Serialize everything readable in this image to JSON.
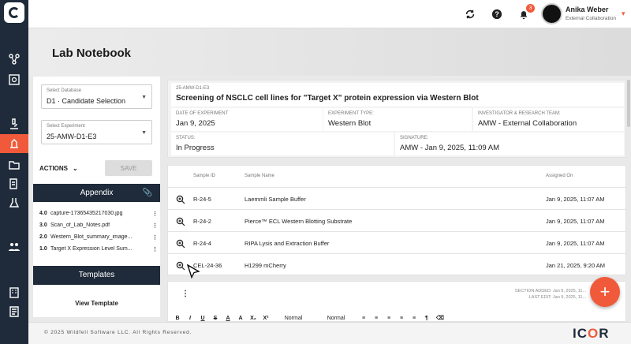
{
  "app": {
    "page_title": "Lab Notebook"
  },
  "user": {
    "name": "Anika Weber",
    "role": "External Collaboration",
    "notification_count": "3"
  },
  "nav": {
    "icons": [
      "logo-icon",
      "molecule-icon",
      "flask-grid-icon",
      "microscope-icon",
      "lab-notebook-icon",
      "folder-icon",
      "document-edit-icon",
      "experiment-icon",
      "team-icon",
      "building-icon",
      "report-icon"
    ]
  },
  "selectors": {
    "database": {
      "label": "Select Database",
      "value": "D1 · Candidate Selection"
    },
    "experiment": {
      "label": "Select Experiment",
      "value": "25-AMW-D1-E3"
    }
  },
  "actions": {
    "actions_label": "ACTIONS",
    "save_label": "SAVE"
  },
  "appendix": {
    "title": "Appendix",
    "items": [
      {
        "version": "4.0",
        "name": "capture-17365435217030.jpg"
      },
      {
        "version": "3.0",
        "name": "Scan_of_Lab_Notes.pdf"
      },
      {
        "version": "2.0",
        "name": "Western_Blot_summary_image..."
      },
      {
        "version": "1.0",
        "name": "Target X Expression Level Sum..."
      }
    ]
  },
  "templates": {
    "title": "Templates",
    "view_label": "View Template"
  },
  "experiment": {
    "id": "25-AMW-D1-E3",
    "title": "Screening of NSCLC cell lines for \"Target X\" protein expression via Western Blot",
    "date_label": "DATE OF EXPERIMENT",
    "date": "Jan 9, 2025",
    "type_label": "EXPERIMENT TYPE:",
    "type": "Western Blot",
    "investigator_label": "INVESTIGATOR & RESEARCH TEAM:",
    "investigator": "AMW - External Collaboration",
    "status_label": "STATUS:",
    "status": "In Progress",
    "signature_label": "SIGNATURE:",
    "signature": "AMW - Jan 9, 2025, 11:09 AM"
  },
  "samples": {
    "headers": {
      "id": "Sample ID",
      "name": "Sample Name",
      "assigned": "Assigned On"
    },
    "rows": [
      {
        "id": "R-24-5",
        "name": "Laemmli Sample Buffer",
        "assigned": "Jan 9, 2025, 11:07 AM"
      },
      {
        "id": "R-24-2",
        "name": "Pierce™ ECL Western Blotting Substrate",
        "assigned": "Jan 9, 2025, 11:07 AM"
      },
      {
        "id": "R-24-4",
        "name": "RIPA Lysis and Extraction Buffer",
        "assigned": "Jan 9, 2025, 11:07 AM"
      },
      {
        "id": "CEL-24-36",
        "name": "H1299 mCherry",
        "assigned": "Jan 21, 2025, 9:20 AM"
      }
    ]
  },
  "editor": {
    "section_added": "SECTION ADDED: Jan 9, 2025, 11...",
    "last_edit": "LAST EDIT: Jan 9, 2025, 11...",
    "toolbar": [
      "B",
      "I",
      "U",
      "S",
      "A",
      "A",
      "X₂",
      "X²",
      "Normal",
      "Normal",
      "≡",
      "≡",
      "≡",
      "≡",
      "≡",
      "¶",
      "⌫"
    ]
  },
  "footer": {
    "copyright": "© 2025 Wildfell Software LLC. All Rights Reserved.",
    "brand_left": "IC",
    "brand_o": "O",
    "brand_right": "R"
  },
  "colors": {
    "accent": "#f05a3a",
    "navy": "#1f2b3a"
  }
}
